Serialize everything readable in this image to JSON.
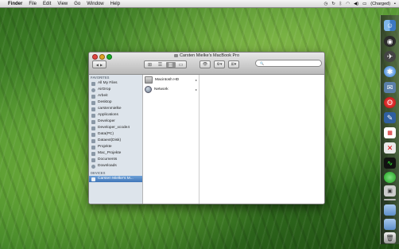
{
  "menubar": {
    "apple": "",
    "items": [
      "Finder",
      "File",
      "Edit",
      "View",
      "Go",
      "Window",
      "Help"
    ],
    "battery_status": "(Charged)",
    "status_icons": [
      "time-machine-icon",
      "sync-icon",
      "bluetooth-icon",
      "wifi-icon",
      "volume-icon",
      "battery-icon"
    ]
  },
  "window": {
    "title": "Carsten Mielke’s MacBook Pro",
    "toolbar": {
      "back_glyph": "◀",
      "forward_glyph": "▶",
      "view_glyphs": [
        "⊞",
        "☰",
        "▥",
        "▭"
      ],
      "quicklook_glyph": "👁",
      "action_glyph": "⚙▾",
      "arrange_glyph": "⊞▾",
      "search_glyph": "🔍",
      "search_placeholder": ""
    },
    "sidebar": {
      "favorites_header": "FAVORITES",
      "favorites": [
        "All My Files",
        "AirDrop",
        "Arbeit",
        "Desktop",
        "carstenmielke",
        "Applications",
        "Developer",
        "Developer_xcode4",
        "Data(PC)",
        "Dataext(Disk)",
        "Projekte",
        "Mac_Projekte",
        "Documents",
        "Downloads"
      ],
      "devices_header": "DEVICES",
      "devices": [
        "Carsten Mielke’s M..."
      ]
    },
    "column1": [
      {
        "name": "Macintosh HD",
        "icon": "hard-disk-icon"
      },
      {
        "name": "Network",
        "icon": "network-icon"
      }
    ]
  },
  "colors": {
    "selection_start": "#6fa2d8",
    "selection_end": "#3f75b8",
    "sidebar_bg": "#dde4eb"
  }
}
